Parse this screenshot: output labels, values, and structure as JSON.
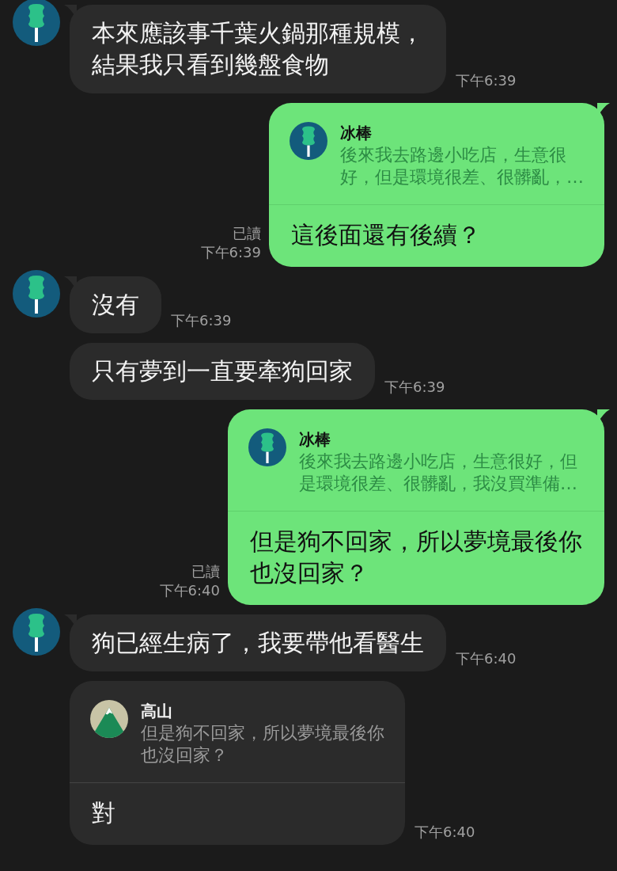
{
  "messages": [
    {
      "kind": "incoming",
      "avatar": {
        "kind": "popsicle"
      },
      "tail": true,
      "lines": [
        "本來應該事千葉火鍋那種規模，",
        "結果我只看到幾盤食物"
      ],
      "time": "下午6:39"
    },
    {
      "kind": "outgoing",
      "tail": true,
      "quote": {
        "avatar": {
          "kind": "popsicle"
        },
        "name": "冰棒",
        "lines": [
          "後來我去路邊小吃店，生意很",
          "好，但是環境很差、很髒亂，…"
        ]
      },
      "lines": [
        "這後面還有後續？"
      ],
      "read": "已讀",
      "time": "下午6:39"
    },
    {
      "kind": "incoming",
      "avatar": {
        "kind": "popsicle"
      },
      "tail": true,
      "lines": [
        "沒有"
      ],
      "time": "下午6:39"
    },
    {
      "kind": "incoming",
      "tail": false,
      "lines": [
        "只有夢到一直要牽狗回家"
      ],
      "time": "下午6:39"
    },
    {
      "kind": "outgoing",
      "tail": true,
      "quote": {
        "avatar": {
          "kind": "popsicle"
        },
        "name": "冰棒",
        "lines": [
          "後來我去路邊小吃店，生意很好，但",
          "是環境很差、很髒亂，我沒買準備…"
        ]
      },
      "lines": [
        "但是狗不回家，所以夢境最後你",
        "也沒回家？"
      ],
      "read": "已讀",
      "time": "下午6:40"
    },
    {
      "kind": "incoming",
      "avatar": {
        "kind": "popsicle"
      },
      "tail": true,
      "lines": [
        "狗已經生病了，我要帶他看醫生"
      ],
      "time": "下午6:40"
    },
    {
      "kind": "incoming",
      "tail": false,
      "quote": {
        "avatar": {
          "kind": "mountain"
        },
        "name": "高山",
        "lines": [
          "但是狗不回家，所以夢境最後你",
          "也沒回家？"
        ]
      },
      "lines": [
        "對"
      ],
      "time": "下午6:40"
    }
  ]
}
